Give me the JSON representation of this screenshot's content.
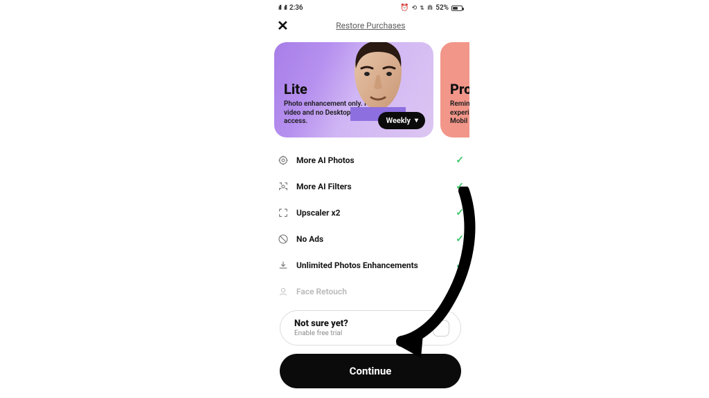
{
  "status": {
    "time": "2:36",
    "battery": "52%"
  },
  "top": {
    "restore": "Restore Purchases"
  },
  "plans": {
    "lite": {
      "title": "Lite",
      "desc": "Photo enhancement only. No video and no Desktop access.",
      "pill": "Weekly"
    },
    "pro": {
      "title": "Pro",
      "desc_line1": "Remin",
      "desc_line2": "experi",
      "desc_line3": "Mobil"
    }
  },
  "features": [
    {
      "label": "More AI Photos"
    },
    {
      "label": "More AI Filters"
    },
    {
      "label": "Upscaler x2"
    },
    {
      "label": "No Ads"
    },
    {
      "label": "Unlimited Photos Enhancements"
    },
    {
      "label": "Face Retouch"
    }
  ],
  "trial": {
    "title": "Not sure yet?",
    "sub": "Enable free trial"
  },
  "cta": "Continue"
}
